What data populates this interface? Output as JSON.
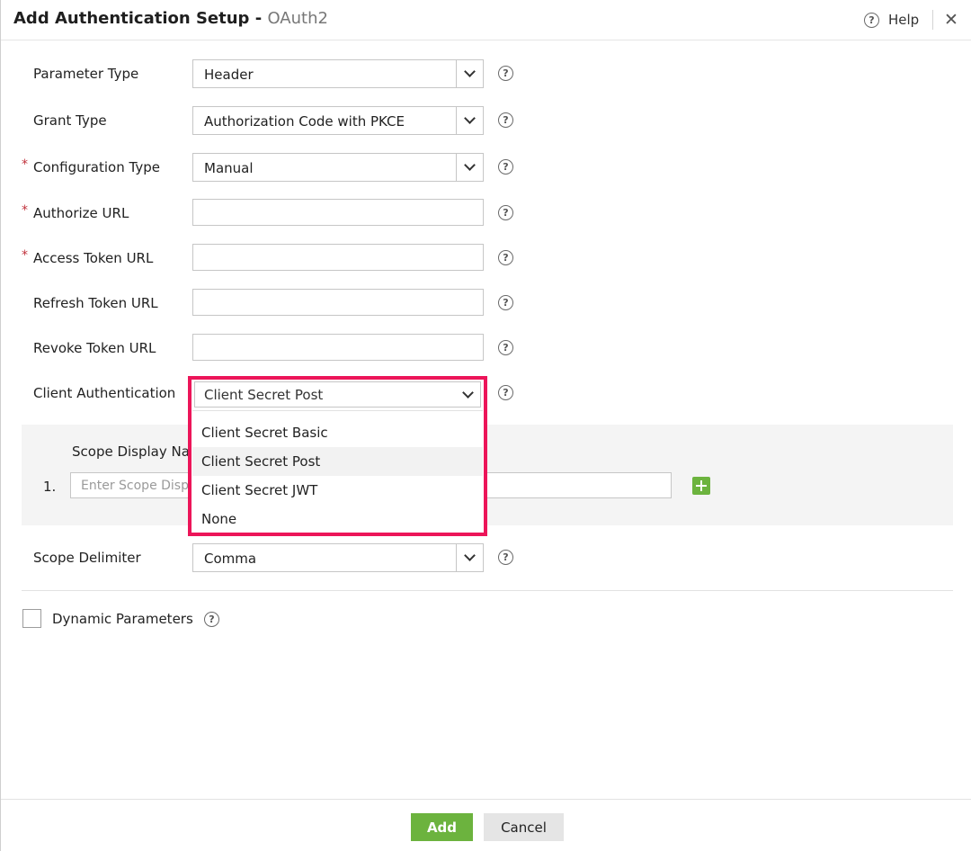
{
  "header": {
    "title": "Add Authentication Setup - ",
    "subtitle": "OAuth2",
    "help_label": "Help",
    "close_glyph": "✕"
  },
  "form": {
    "parameter_type": {
      "label": "Parameter Type",
      "value": "Header"
    },
    "grant_type": {
      "label": "Grant Type",
      "value": "Authorization Code with PKCE"
    },
    "configuration_type": {
      "label": "Configuration Type",
      "value": "Manual",
      "required": true
    },
    "authorize_url": {
      "label": "Authorize URL",
      "value": "",
      "required": true
    },
    "access_token_url": {
      "label": "Access Token URL",
      "value": "",
      "required": true
    },
    "refresh_token_url": {
      "label": "Refresh Token URL",
      "value": ""
    },
    "revoke_token_url": {
      "label": "Revoke Token URL",
      "value": ""
    },
    "client_authentication": {
      "label": "Client Authentication",
      "value": "Client Secret Post",
      "options": [
        "Client Secret Basic",
        "Client Secret Post",
        "Client Secret JWT",
        "None"
      ],
      "selected_index": 1
    },
    "scope_delimiter": {
      "label": "Scope Delimiter",
      "value": "Comma"
    }
  },
  "scope": {
    "title": "Scope Display Name",
    "rows": [
      {
        "number": "1.",
        "value": "",
        "placeholder": "Enter Scope Display Name"
      }
    ]
  },
  "dynamic_parameters": {
    "label": "Dynamic Parameters",
    "checked": false
  },
  "footer": {
    "add_label": "Add",
    "cancel_label": "Cancel"
  },
  "required_marker": "*",
  "help_glyph": "?",
  "colors": {
    "accent_green": "#6cb33e",
    "highlight_border": "#ec1559",
    "required_red": "#c0313b"
  },
  "icons": {
    "help": "question-circle-icon",
    "close": "close-icon",
    "dropdown": "chevron-down-icon",
    "add": "plus-icon"
  }
}
